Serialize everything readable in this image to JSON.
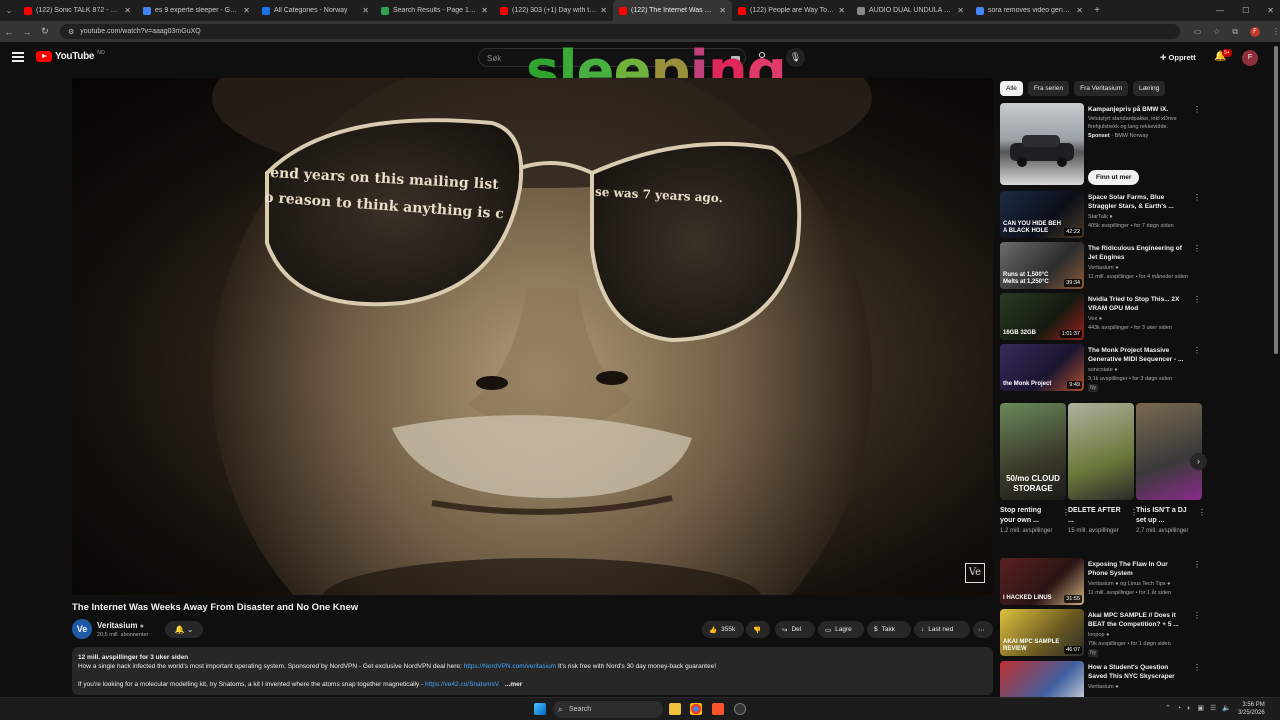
{
  "browser": {
    "tabs": [
      {
        "title": "(122) Sonic TALK 872 - Nadia Sl",
        "favicon_color": "#ff0000"
      },
      {
        "title": "es 9 experte sleeper - Google S",
        "favicon_color": "#4285f4"
      },
      {
        "title": "All Categories - Norway",
        "favicon_color": "#1a73e8"
      },
      {
        "title": "Search Results - Page 1 - \"dual",
        "favicon_color": "#2ea44f"
      },
      {
        "title": "(122) 303 (+1) Day with the DA",
        "favicon_color": "#ff0000"
      },
      {
        "title": "(122) The Internet Was Wee",
        "favicon_color": "#ff0000",
        "active": true
      },
      {
        "title": "(122) People are Way Too Crea",
        "favicon_color": "#ff0000"
      },
      {
        "title": "AUDIO DUAL UNDULA OSCILL",
        "favicon_color": "#888888"
      },
      {
        "title": "sora removes video generating",
        "favicon_color": "#4285f4"
      }
    ],
    "url": "youtube.com/watch?v=aaag03mGuXQ"
  },
  "youtube": {
    "logo_text": "YouTube",
    "logo_country": "NO",
    "search_placeholder": "Søk",
    "overlay_text": "sleeping",
    "create_label": "Opprett",
    "notification_count": "9+",
    "avatar_letter": "F"
  },
  "video": {
    "lens_text_1": "end years on this mailing list",
    "lens_text_2": "o reason to think anything is c",
    "lens_text_3": "se was 7 years ago.",
    "watermark": "Ve",
    "title": "The Internet Was Weeks Away From Disaster and No One Knew",
    "channel": {
      "name": "Veritasium",
      "subs": "20,5 mill. abonnenter",
      "avatar": "Ve"
    },
    "actions": {
      "likes": "355k",
      "share": "Del",
      "save": "Lagre",
      "thanks": "Takk",
      "download": "Last ned"
    },
    "description": {
      "stats": "12 mill. avspillinger  for 3 uker siden",
      "line1_pre": "How a single hack infected the world's most important operating system. Sponsored by NordVPN - Get exclusive NordVPN deal here:",
      "line1_link": "https://NordVPN.com/veritasium",
      "line1_post": "It's risk free with Nord's 30 day money-back guarantee!",
      "line2_pre": "If you're looking for a molecular modelling kit, try Snatoms, a kit I invented where the atoms snap together magnetically -",
      "line2_link": "https://ve42.co/SnatomsV",
      "more": "...mer"
    }
  },
  "sidebar": {
    "chips": [
      "Alle",
      "Fra serien",
      "Fra Veritasium",
      "Læring"
    ],
    "ad": {
      "title": "Kampanjepris på BMW iX.",
      "desc": "Velutstyrt standardpakke, inkl xDrive firehjulstrekk og lang rekkevidde.",
      "sponsor": "Sponset",
      "advertiser": "BMW Norway",
      "cta": "Finn ut mer"
    },
    "videos": [
      {
        "title": "Space Solar Farms, Blue Straggler Stars, & Earth's ...",
        "channel": "StarTalk",
        "meta": "405k avspillinger • for 7 døgn siden",
        "duration": "42:22",
        "thumb_text": "CAN YOU HIDE BEH A BLACK HOLE"
      },
      {
        "title": "The Ridiculous Engineering of Jet Engines",
        "channel": "Veritasium",
        "meta": "11 mill. avspillinger • for 4 måneder siden",
        "duration": "39:34",
        "thumb_text": "Runs at 1,500°C  Melts at 1,250°C"
      },
      {
        "title": "Nvidia Tried to Stop This... 2X VRAM GPU Mod",
        "channel": "Vex",
        "meta": "443k avspillinger • for 3 uker siden",
        "duration": "1:01:37",
        "thumb_text": "16GB 32GB"
      },
      {
        "title": "The Monk Project Massive Generative MIDI Sequencer - ...",
        "channel": "sonicstate",
        "meta": "3,1k avspillinger • for 3 døgn siden",
        "duration": "9:49",
        "badge": "Ny",
        "thumb_text": "the Monk Project"
      },
      {
        "title": "Exposing The Flaw In Our Phone System",
        "channel": "Veritasium",
        "channel2": "og Linus Tech Tips",
        "meta": "11 mill. avspillinger • for 1 år siden",
        "duration": "31:55",
        "thumb_text": "I HACKED LINUS"
      },
      {
        "title": "Akai MPC SAMPLE // Does it BEAT the Competition? + 5 ...",
        "channel": "loopop",
        "meta": "79k avspillinger • for 1 døgn siden",
        "duration": "46:07",
        "badge": "Ny",
        "thumb_text": "AKAI MPC SAMPLE   REVIEW"
      },
      {
        "title": "How a Student's Question Saved This NYC Skyscraper",
        "channel": "Veritasium",
        "meta": "",
        "duration": "",
        "thumb_text": ""
      }
    ],
    "shorts": [
      {
        "title": "Stop renting your own ...",
        "views": "1,2 mill. avspillinger",
        "overlay": "50/mo CLOUD STORAGE"
      },
      {
        "title": "DELETE AFTER ...",
        "views": "15 mill. avspillinger",
        "overlay": ""
      },
      {
        "title": "This ISN'T a DJ set up ...",
        "views": "2,7 mill. avspillinger",
        "overlay": ""
      }
    ]
  },
  "taskbar": {
    "search_label": "Search",
    "time": "3:56 PM",
    "date": "3/25/2026"
  }
}
